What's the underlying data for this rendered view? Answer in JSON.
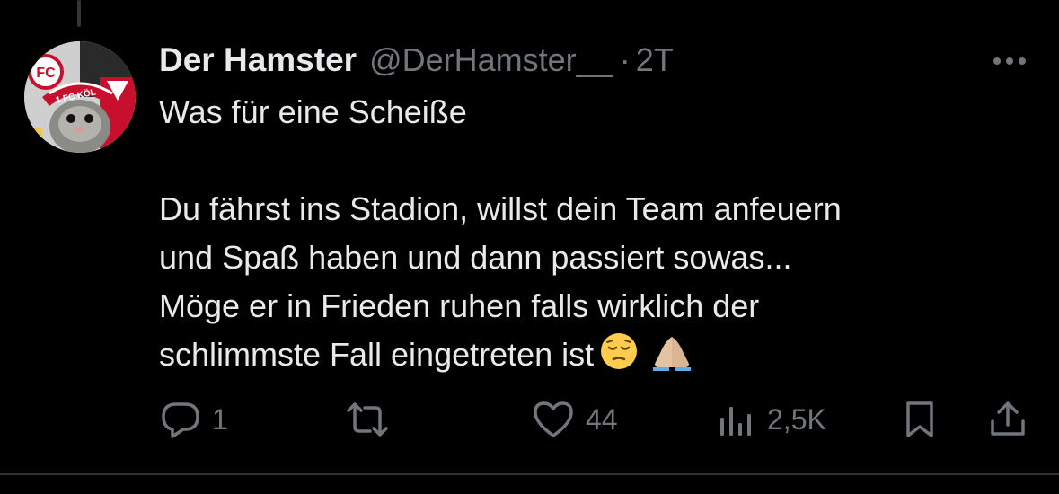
{
  "tweet": {
    "author_name": "Der Hamster",
    "handle": "@DerHamster__",
    "separator": "·",
    "timestamp": "2T",
    "lines": [
      "Was für eine Scheiße",
      "",
      "Du fährst ins Stadion, willst dein Team anfeuern",
      "und Spaß haben und dann passiert sowas...",
      "Möge er in Frieden ruhen falls wirklich der",
      "schlimmste Fall eingetreten ist"
    ],
    "emojis": [
      "pensive-face",
      "folded-hands"
    ],
    "avatar_text": "1.FC KÖL"
  },
  "actions": {
    "reply": {
      "icon": "reply-icon",
      "count": "1"
    },
    "retweet": {
      "icon": "retweet-icon",
      "count": ""
    },
    "like": {
      "icon": "heart-icon",
      "count": "44"
    },
    "views": {
      "icon": "views-icon",
      "count": "2,5K"
    },
    "bookmark": {
      "icon": "bookmark-icon"
    },
    "share": {
      "icon": "share-icon"
    }
  },
  "colors": {
    "background": "#000000",
    "text_primary": "#e7e9ea",
    "text_secondary": "#71767b",
    "divider": "#2f3336"
  }
}
